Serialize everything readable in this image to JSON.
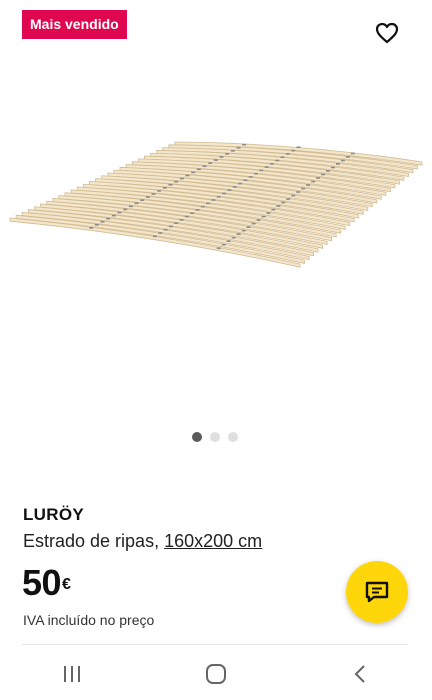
{
  "badge": {
    "label": "Mais vendido"
  },
  "product": {
    "name": "LURÖY",
    "description": "Estrado de ripas, ",
    "size": "160x200 cm",
    "price": "50",
    "currency": "€",
    "vat_note": "IVA incluído no preço"
  },
  "carousel": {
    "total": 3,
    "active": 1
  },
  "icons": {
    "favorite": "heart-outline-icon",
    "chat": "chat-bubble-icon",
    "nav_recents": "recent-apps-icon",
    "nav_home": "home-icon",
    "nav_back": "back-icon"
  },
  "colors": {
    "badge": "#e00751",
    "chat_button": "#ffd60a",
    "active_dot": "#5a5a5a"
  }
}
